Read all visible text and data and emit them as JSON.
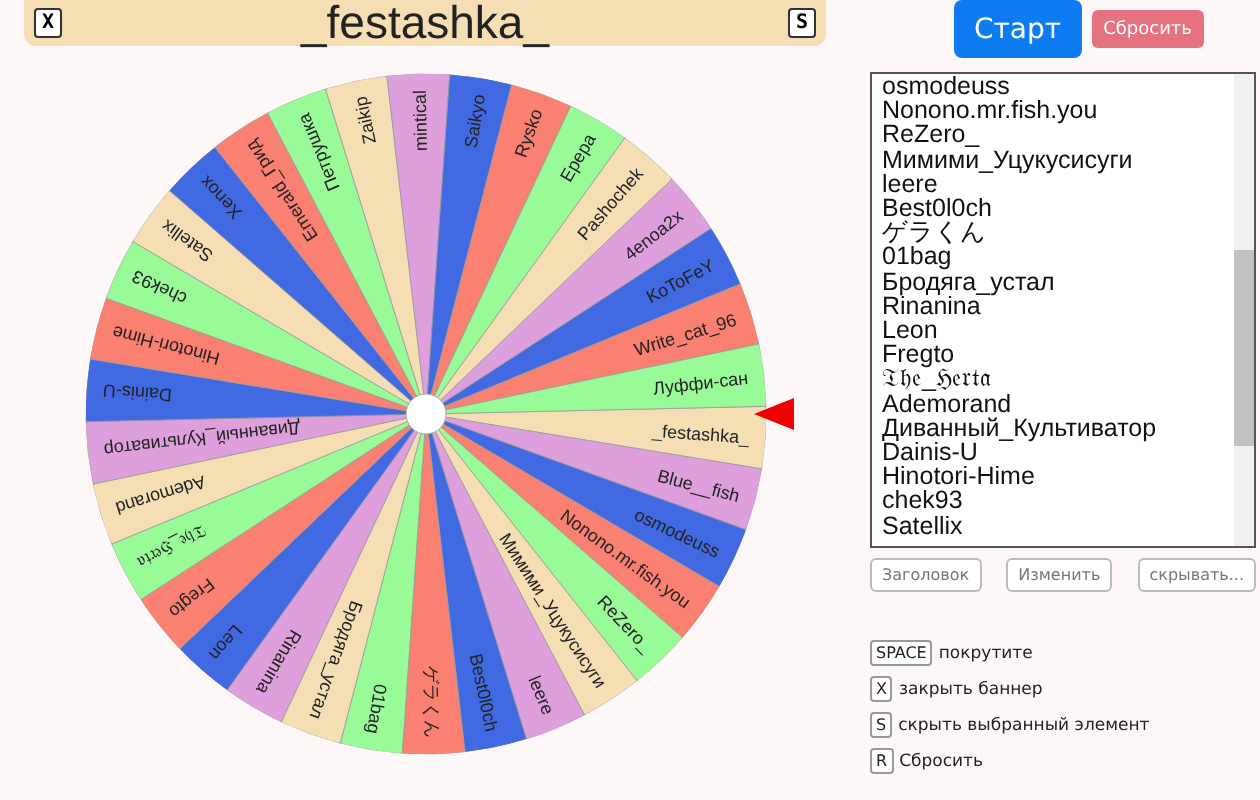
{
  "banner": {
    "title": "_festashka_",
    "close_key": "X",
    "hide_key": "S"
  },
  "buttons": {
    "start": "Старт",
    "reset": "Сбросить"
  },
  "wheel": {
    "segments": [
      {
        "label": "_festashka_",
        "color": "#f5deb3"
      },
      {
        "label": "Blue__fish",
        "color": "#dda0dd"
      },
      {
        "label": "osmodeuss",
        "color": "#4169e1"
      },
      {
        "label": "Nonono.mr.fish.you",
        "color": "#fa8072"
      },
      {
        "label": "ReZero_",
        "color": "#98fb98"
      },
      {
        "label": "Мимими_Уцукусисуги",
        "color": "#f5deb3"
      },
      {
        "label": "leere",
        "color": "#dda0dd"
      },
      {
        "label": "Best0l0ch",
        "color": "#4169e1"
      },
      {
        "label": "ゲラくん",
        "color": "#fa8072"
      },
      {
        "label": "01bag",
        "color": "#98fb98"
      },
      {
        "label": "Бродяга_устал",
        "color": "#f5deb3"
      },
      {
        "label": "Rinanina",
        "color": "#dda0dd"
      },
      {
        "label": "Leon",
        "color": "#4169e1"
      },
      {
        "label": "Fregto",
        "color": "#fa8072"
      },
      {
        "label": "𝔗𝔥𝔢_ℌ𝔢𝔯𝔱𝔞",
        "color": "#98fb98"
      },
      {
        "label": "Ademorand",
        "color": "#f5deb3"
      },
      {
        "label": "Диванный_Культиватор",
        "color": "#dda0dd"
      },
      {
        "label": "Dainis-U",
        "color": "#4169e1"
      },
      {
        "label": "Hinotori-Hime",
        "color": "#fa8072"
      },
      {
        "label": "chek93",
        "color": "#98fb98"
      },
      {
        "label": "Satellix",
        "color": "#f5deb3"
      },
      {
        "label": "Xenox",
        "color": "#4169e1"
      },
      {
        "label": "Emerald_Грид",
        "color": "#fa8072"
      },
      {
        "label": "Петрушка",
        "color": "#98fb98"
      },
      {
        "label": "Zaikip",
        "color": "#f5deb3"
      },
      {
        "label": "mintical",
        "color": "#dda0dd"
      },
      {
        "label": "Saikyo",
        "color": "#4169e1"
      },
      {
        "label": "Rysko",
        "color": "#fa8072"
      },
      {
        "label": "Ерера",
        "color": "#98fb98"
      },
      {
        "label": "Pashochek",
        "color": "#f5deb3"
      },
      {
        "label": "4enoa2x",
        "color": "#dda0dd"
      },
      {
        "label": "KoToFeY",
        "color": "#4169e1"
      },
      {
        "label": "Write_cat_96",
        "color": "#fa8072"
      },
      {
        "label": "Луффи-сан",
        "color": "#98fb98"
      }
    ]
  },
  "list": {
    "items": [
      "osmodeuss",
      "Nonono.mr.fish.you",
      "ReZero_",
      "Мимими_Уцукусисуги",
      "leere",
      "Best0l0ch",
      "ゲラくん",
      "01bag",
      "Бродяга_устал",
      "Rinanina",
      "Leon",
      "Fregto",
      "𝔗𝔥𝔢_ℌ𝔢𝔯𝔱𝔞",
      "Ademorand",
      "Диванный_Культиватор",
      "Dainis-U",
      "Hinotori-Hime",
      "chek93",
      "Satellix"
    ]
  },
  "list_buttons": [
    "Заголовок",
    "Изменить",
    "скрывать..."
  ],
  "shortcuts": [
    {
      "key": "SPACE",
      "label": "покрутите"
    },
    {
      "key": "X",
      "label": "закрыть баннер"
    },
    {
      "key": "S",
      "label": "скрыть выбранный элемент"
    },
    {
      "key": "R",
      "label": "Сбросить"
    }
  ]
}
